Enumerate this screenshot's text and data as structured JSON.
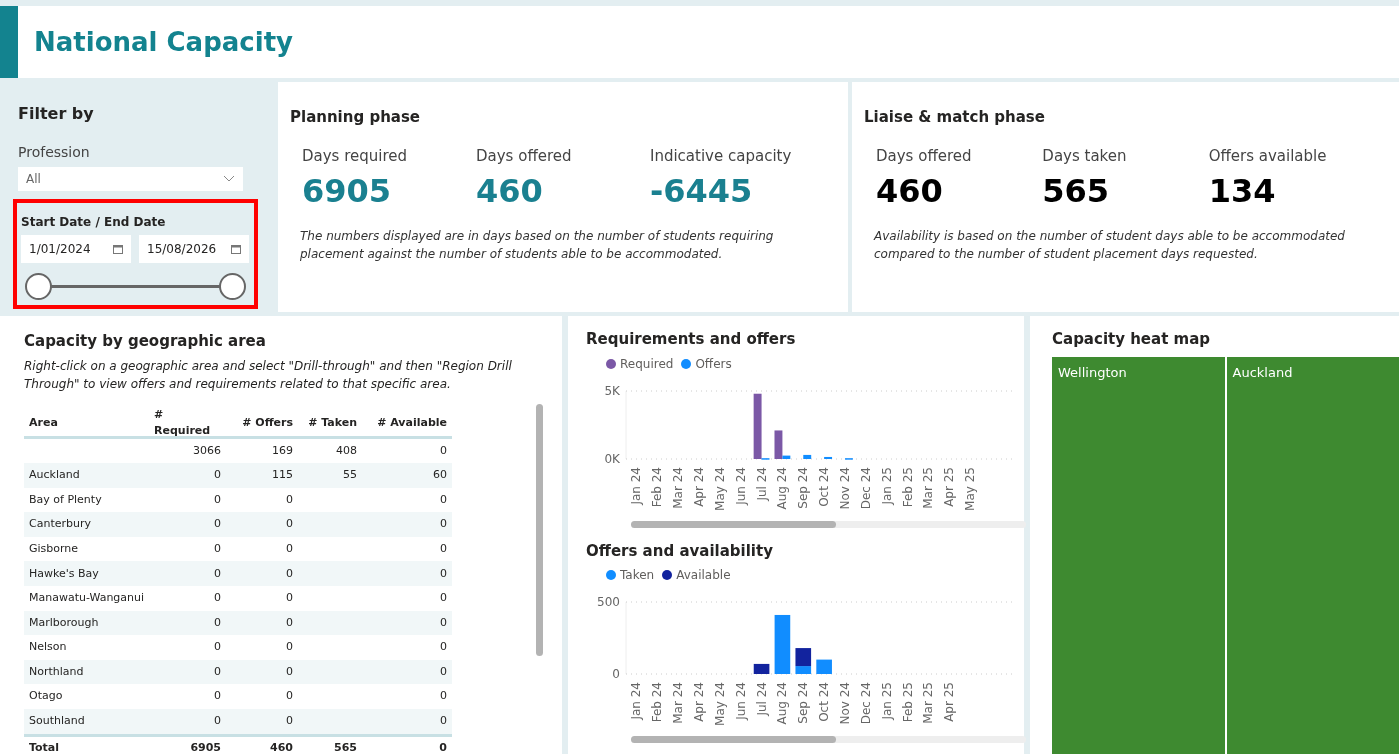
{
  "page": {
    "title": "National Capacity"
  },
  "filters": {
    "title": "Filter by",
    "profession": {
      "label": "Profession",
      "value": "All"
    },
    "date_range": {
      "label": "Start Date / End Date",
      "start": "1/01/2024",
      "end": "15/08/2026",
      "highlighted": true
    }
  },
  "planning": {
    "title": "Planning phase",
    "kpis": [
      {
        "label": "Days required",
        "value": "6905"
      },
      {
        "label": "Days offered",
        "value": "460"
      },
      {
        "label": "Indicative capacity",
        "value": "-6445"
      }
    ],
    "note": "The numbers displayed are in days based on the number of students requiring placement against the number of students able to be accommodated."
  },
  "liaise": {
    "title": "Liaise & match phase",
    "kpis": [
      {
        "label": "Days offered",
        "value": "460"
      },
      {
        "label": "Days taken",
        "value": "565"
      },
      {
        "label": "Offers available",
        "value": "134"
      }
    ],
    "note": "Availability is based on the number of student days able to be accommodated compared to the number of student placement days requested."
  },
  "geo": {
    "title": "Capacity by geographic area",
    "subtitle": "Right-click on a geographic area and select \"Drill-through\" and then \"Region Drill Through\" to view offers and requirements related to that specific area.",
    "columns": [
      "Area",
      "# Required",
      "# Offers",
      "# Taken",
      "# Available"
    ],
    "rows": [
      [
        "",
        "3066",
        "169",
        "408",
        "0"
      ],
      [
        "Auckland",
        "0",
        "115",
        "55",
        "60"
      ],
      [
        "Bay of Plenty",
        "0",
        "0",
        "",
        "0"
      ],
      [
        "Canterbury",
        "0",
        "0",
        "",
        "0"
      ],
      [
        "Gisborne",
        "0",
        "0",
        "",
        "0"
      ],
      [
        "Hawke's Bay",
        "0",
        "0",
        "",
        "0"
      ],
      [
        "Manawatu-Wanganui",
        "0",
        "0",
        "",
        "0"
      ],
      [
        "Marlborough",
        "0",
        "0",
        "",
        "0"
      ],
      [
        "Nelson",
        "0",
        "0",
        "",
        "0"
      ],
      [
        "Northland",
        "0",
        "0",
        "",
        "0"
      ],
      [
        "Otago",
        "0",
        "0",
        "",
        "0"
      ],
      [
        "Southland",
        "0",
        "0",
        "",
        "0"
      ]
    ],
    "total": [
      "Total",
      "6905",
      "460",
      "565",
      "0"
    ]
  },
  "req_chart": {
    "chart_data": {
      "type": "bar",
      "title": "Requirements and offers",
      "categories": [
        "Jan 24",
        "Feb 24",
        "Mar 24",
        "Apr 24",
        "May 24",
        "Jun 24",
        "Jul 24",
        "Aug 24",
        "Sep 24",
        "Oct 24",
        "Nov 24",
        "Dec 24",
        "Jan 25",
        "Feb 25",
        "Mar 25",
        "Apr 25",
        "May 25"
      ],
      "series": [
        {
          "name": "Required",
          "color": "#7b58a6",
          "values": [
            0,
            0,
            0,
            0,
            0,
            0,
            4800,
            2100,
            0,
            0,
            0,
            0,
            0,
            0,
            0,
            0,
            0
          ]
        },
        {
          "name": "Offers",
          "color": "#118dff",
          "values": [
            0,
            0,
            0,
            0,
            0,
            0,
            60,
            250,
            300,
            150,
            60,
            0,
            0,
            0,
            0,
            0,
            0
          ]
        }
      ],
      "legend": "top",
      "ylim": [
        0,
        5000
      ],
      "yticks": [
        {
          "value": 0,
          "label": "0K"
        },
        {
          "value": 5000,
          "label": "5K"
        }
      ]
    }
  },
  "offers_chart": {
    "chart_data": {
      "type": "bar",
      "title": "Offers and availability",
      "stacked": true,
      "categories": [
        "Jan 24",
        "Feb 24",
        "Mar 24",
        "Apr 24",
        "May 24",
        "Jun 24",
        "Jul 24",
        "Aug 24",
        "Sep 24",
        "Oct 24",
        "Nov 24",
        "Dec 24",
        "Jan 25",
        "Feb 25",
        "Mar 25",
        "Apr 25"
      ],
      "series": [
        {
          "name": "Taken",
          "color": "#118dff",
          "values": [
            0,
            0,
            0,
            0,
            0,
            0,
            0,
            410,
            55,
            100,
            0,
            0,
            0,
            0,
            0,
            0
          ]
        },
        {
          "name": "Available",
          "color": "#12239e",
          "values": [
            0,
            0,
            0,
            0,
            0,
            0,
            70,
            0,
            125,
            0,
            0,
            0,
            0,
            0,
            0,
            0
          ]
        }
      ],
      "legend": "top",
      "ylim": [
        0,
        500
      ],
      "yticks": [
        0,
        500
      ]
    }
  },
  "heat_map": {
    "title": "Capacity heat map",
    "tiles": [
      {
        "label": "Wellington"
      },
      {
        "label": "Auckland"
      }
    ]
  }
}
